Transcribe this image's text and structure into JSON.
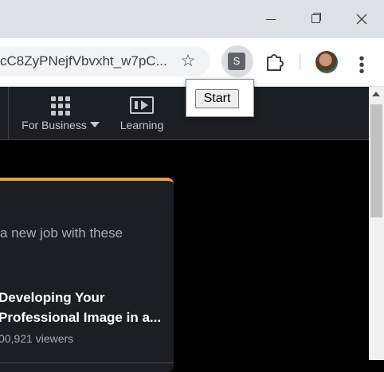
{
  "browser": {
    "url_text": "cC8ZyPNejfVbvxht_w7pC...",
    "extension_letter": "S",
    "popup": {
      "button_label": "Start"
    }
  },
  "nav": {
    "items": [
      {
        "label": "For Business",
        "icon": "grid-icon",
        "has_dropdown": true
      },
      {
        "label": "Learning",
        "icon": "learning-play-icon"
      }
    ]
  },
  "card": {
    "subtitle": "a new job with these",
    "title": "Developing Your Professional Image in a...",
    "viewers": "00,921 viewers",
    "accent_color": "#e7a33e"
  },
  "colors": {
    "page_bg": "#000000",
    "nav_bg": "#1b1f23",
    "card_bg": "#1b1f23"
  }
}
